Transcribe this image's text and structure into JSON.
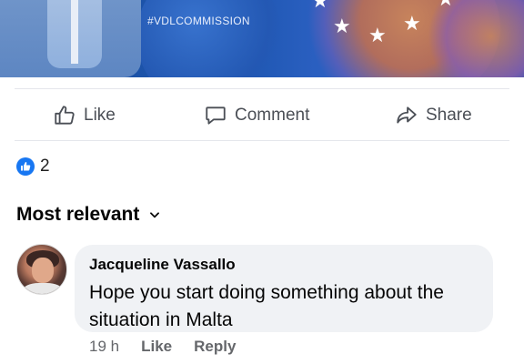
{
  "post": {
    "banner": {
      "hashtag": "#VDLCOMMISSION",
      "star_glyph": "★"
    },
    "actions": {
      "like_label": "Like",
      "comment_label": "Comment",
      "share_label": "Share"
    },
    "reactions": {
      "count": "2",
      "icon": "thumbs-up-icon",
      "color": "#1877f2"
    },
    "comments_sort": {
      "label": "Most relevant",
      "icon": "chevron-down-icon"
    },
    "comments": [
      {
        "author": "Jacqueline Vassallo",
        "text": "Hope you start doing something about the situation in Malta",
        "time": "19 h",
        "like_label": "Like",
        "reply_label": "Reply"
      }
    ]
  }
}
